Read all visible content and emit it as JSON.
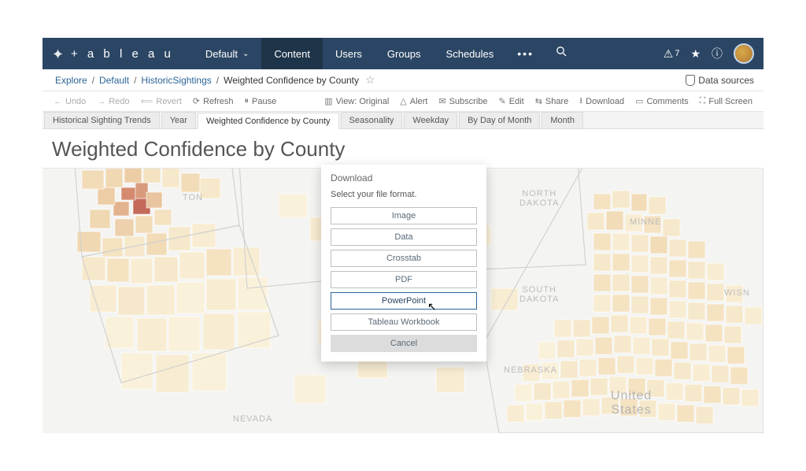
{
  "brand": "+ a b l e a u",
  "nav": {
    "site_selector": "Default",
    "items": [
      "Content",
      "Users",
      "Groups",
      "Schedules"
    ],
    "active_index": 0,
    "alert_count": "7"
  },
  "breadcrumb": {
    "items": [
      "Explore",
      "Default",
      "HistoricSightings"
    ],
    "current": "Weighted Confidence by County",
    "data_sources": "Data sources"
  },
  "toolbar": {
    "undo": "Undo",
    "redo": "Redo",
    "revert": "Revert",
    "refresh": "Refresh",
    "pause": "Pause",
    "view_original": "View: Original",
    "alert": "Alert",
    "subscribe": "Subscribe",
    "edit": "Edit",
    "share": "Share",
    "download": "Download",
    "comments": "Comments",
    "full_screen": "Full Screen"
  },
  "tabs": {
    "items": [
      "Historical Sighting Trends",
      "Year",
      "Weighted Confidence by County",
      "Seasonality",
      "Weekday",
      "By Day of Month",
      "Month"
    ],
    "active_index": 2
  },
  "sheet_title": "Weighted Confidence by County",
  "modal": {
    "title": "Download",
    "subtitle": "Select your file format.",
    "options": [
      "Image",
      "Data",
      "Crosstab",
      "PDF",
      "PowerPoint",
      "Tableau Workbook"
    ],
    "selected_index": 4,
    "cancel": "Cancel"
  },
  "map_labels": {
    "nevada": "NEVADA",
    "sd": "SOUTH\nDAKOTA",
    "nd": "NORTH\nDAKOTA",
    "neb": "NEBRASKA",
    "us": "United\nStates",
    "mn": "MINNE",
    "wi": "WISN",
    "wa": "TON"
  }
}
